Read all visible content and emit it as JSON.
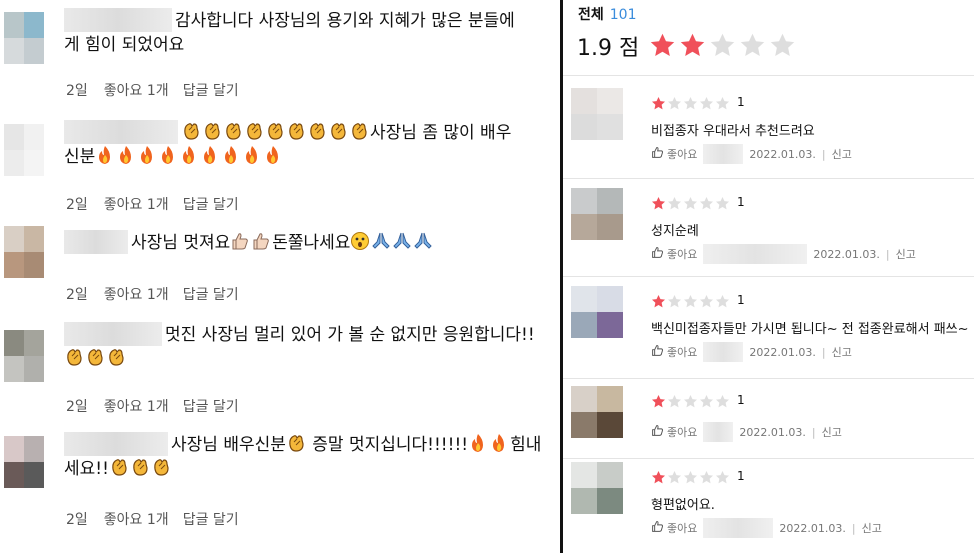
{
  "comments": [
    {
      "name_width": 108,
      "text_before": "감사합니다 사장님의 용기와 지혜가 많은 분들에",
      "text_line2": "게 힘이 되었어요",
      "date": "2일",
      "like": "좋아요 1개",
      "reply": "답글 달기",
      "avatar": [
        "#b8c6c9",
        "#8cb8cc",
        "#d6dadc",
        "#c4ccd0"
      ]
    },
    {
      "name_width": 114,
      "emoji_before": [
        "clap",
        "clap",
        "clap",
        "clap",
        "clap",
        "clap",
        "clap",
        "clap",
        "clap"
      ],
      "text_before": "사장님 좀 많이 배우",
      "text_line2": "신분",
      "emoji_after": [
        "fire",
        "fire",
        "fire",
        "fire",
        "fire",
        "fire",
        "fire",
        "fire",
        "fire"
      ],
      "date": "2일",
      "like": "좋아요 1개",
      "reply": "답글 달기",
      "avatar": [
        "#e6e6e6",
        "#f1f1f1",
        "#ececec",
        "#f4f4f4"
      ]
    },
    {
      "name_width": 64,
      "text_before": "사장님 멋져요",
      "emoji_mid": [
        "thumb",
        "thumb"
      ],
      "text_mid": "돈쭐나세요",
      "emoji_after": [
        "wow",
        "pray",
        "pray",
        "pray"
      ],
      "date": "2일",
      "like": "좋아요 1개",
      "reply": "답글 달기",
      "avatar": [
        "#d9cfc5",
        "#c9b7a4",
        "#b8977e",
        "#a88b74"
      ]
    },
    {
      "name_width": 98,
      "text_before": "멋진 사장님 멀리 있어 가 볼 순 없지만 응원합니다!!",
      "emoji_line2": [
        "clap",
        "clap",
        "clap"
      ],
      "date": "2일",
      "like": "좋아요 1개",
      "reply": "답글 달기",
      "avatar": [
        "#8a8a80",
        "#a4a49c",
        "#c4c4c0",
        "#b0b0ac"
      ]
    },
    {
      "name_width": 104,
      "text_before": "사장님 배우신분",
      "emoji_mid": [
        "clap"
      ],
      "text_mid": " 증말 멋지십니다!!!!!!",
      "emoji_after": [
        "fire",
        "fire"
      ],
      "text_after": "힘내",
      "text_line2": "세요!!",
      "emoji_line2": [
        "clap",
        "clap",
        "clap"
      ],
      "date": "2일",
      "like": "좋아요 1개",
      "reply": "답글 달기",
      "avatar": [
        "#d8c8c8",
        "#b8b0b0",
        "#6a5a58",
        "#5a5a5a"
      ]
    }
  ],
  "summary": {
    "label": "전체",
    "count": "101",
    "score": "1.9 점",
    "rating": 2,
    "max": 5
  },
  "reviews": [
    {
      "rating": 1,
      "rating_text": "1",
      "text": "비접종자 우대라서 추천드려요",
      "like": "좋아요",
      "date": "2022.01.03.",
      "report": "신고",
      "blur_width": 40,
      "avatar": [
        "#e4e0de",
        "#ebe8e6",
        "#dcdcdc",
        "#e0e0e0"
      ]
    },
    {
      "rating": 1,
      "rating_text": "1",
      "text": "성지순례",
      "like": "좋아요",
      "date": "2022.01.03.",
      "report": "신고",
      "blur_width": 104,
      "avatar": [
        "#c9cbcc",
        "#b4b8b8",
        "#b6a89a",
        "#a89a8c"
      ]
    },
    {
      "rating": 1,
      "rating_text": "1",
      "text": "백신미접종자들만 가시면 됩니다~ 전 접종완료해서 패쓰~",
      "like": "좋아요",
      "date": "2022.01.03.",
      "report": "신고",
      "blur_width": 40,
      "avatar": [
        "#e0e4ea",
        "#d8dce6",
        "#9aa8b8",
        "#7c6898"
      ]
    },
    {
      "rating": 1,
      "rating_text": "1",
      "text": "",
      "like": "좋아요",
      "date": "2022.01.03.",
      "report": "신고",
      "blur_width": 30,
      "avatar": [
        "#d8d0c8",
        "#c8b8a0",
        "#8a7a6a",
        "#5a4838"
      ]
    },
    {
      "rating": 1,
      "rating_text": "1",
      "text": "형편없어요.",
      "like": "좋아요",
      "date": "2022.01.03.",
      "report": "신고",
      "blur_width": 70,
      "avatar": [
        "#e4e6e4",
        "#c8ccc8",
        "#b0b8b0",
        "#7c8a80"
      ]
    }
  ],
  "colors": {
    "star_on": "#f0505a",
    "star_off": "#dedede",
    "accent": "#3a8cdc"
  },
  "icons": {
    "like": "thumb-up-icon",
    "star": "star-icon",
    "clap": "clapping-hands-emoji",
    "fire": "fire-emoji",
    "thumb": "thumbs-up-emoji",
    "pray": "praying-hands-emoji",
    "wow": "astonished-face-emoji"
  }
}
